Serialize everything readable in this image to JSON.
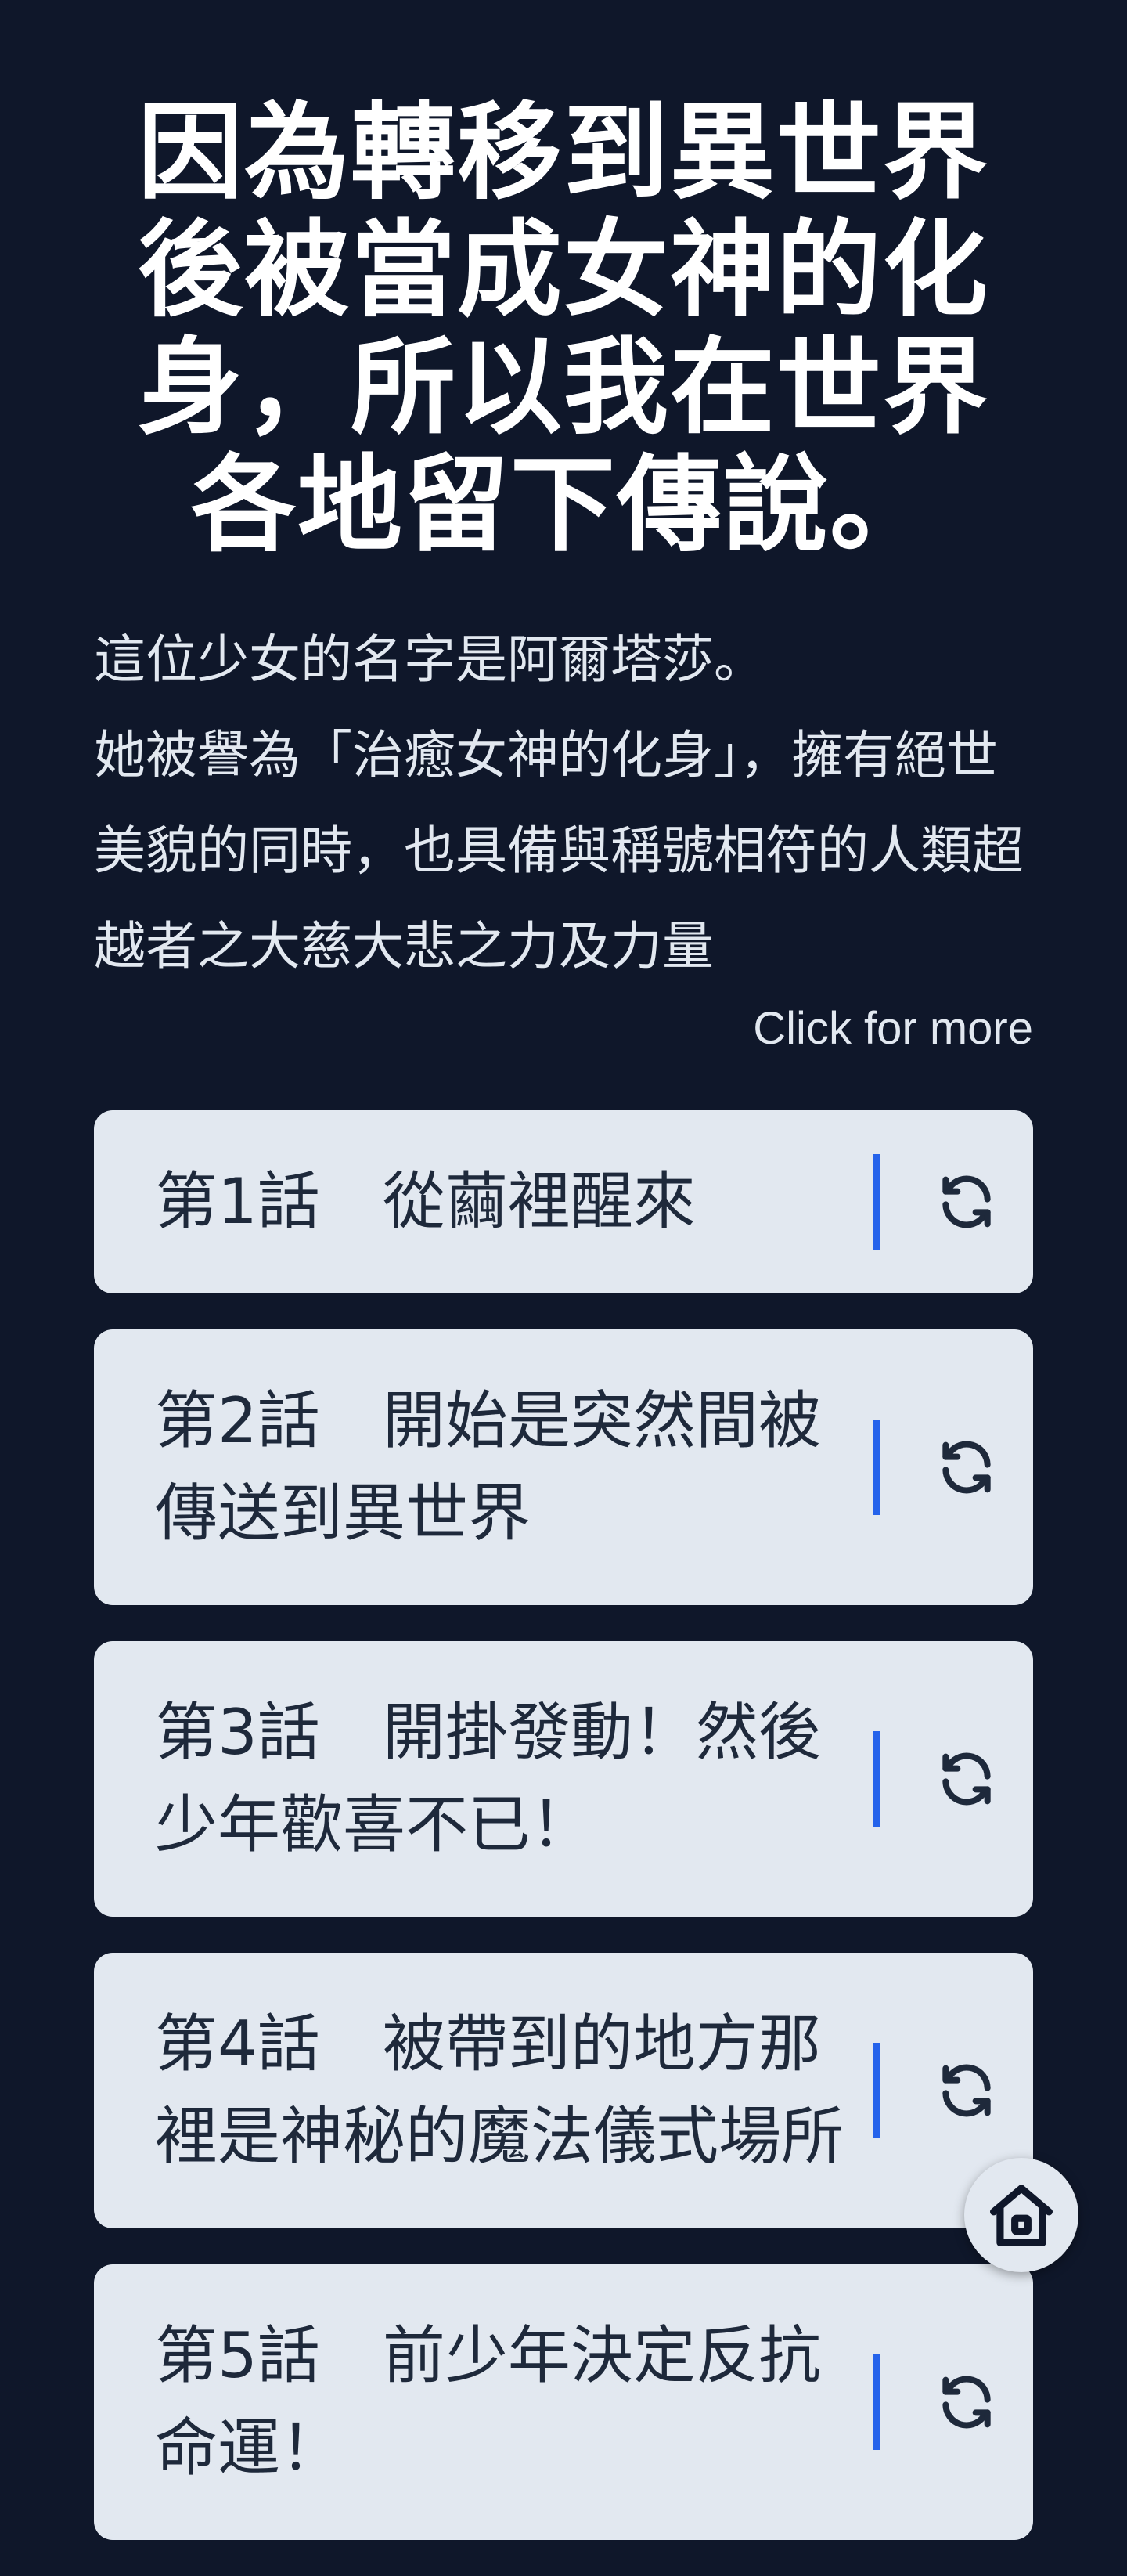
{
  "title": "因為轉移到異世界後被當成女神的化身，所以我在世界各地留下傳說。",
  "synopsis": "這位少女的名字是阿爾塔莎。\n她被譽為「治癒女神的化身」，擁有絕世美貌的同時，也具備與稱號相符的人類超越者之大慈大悲之力及力量",
  "more_label": "Click for more",
  "chapters": [
    {
      "label": "第1話　從繭裡醒來",
      "icon": "refresh-icon"
    },
    {
      "label": "第2話　開始是突然間被傳送到異世界",
      "icon": "refresh-icon"
    },
    {
      "label": "第3話　開掛發動！然後少年歡喜不已！",
      "icon": "refresh-icon"
    },
    {
      "label": "第4話　被帶到的地方那裡是神秘的魔法儀式場所",
      "icon": "refresh-icon"
    },
    {
      "label": "第5話　前少年決定反抗命運！",
      "icon": "refresh-icon"
    }
  ],
  "home_button": {
    "icon": "home-icon"
  },
  "colors": {
    "background": "#0f172a",
    "card": "#e2e8f0",
    "card_text": "#1e293b",
    "accent": "#2563eb",
    "text": "#ffffff"
  }
}
